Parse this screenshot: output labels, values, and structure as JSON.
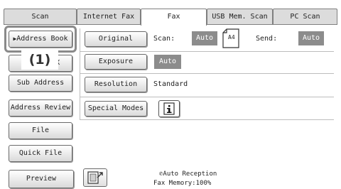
{
  "tabs": [
    {
      "label": "Scan"
    },
    {
      "label": "Internet Fax"
    },
    {
      "label": "Fax"
    },
    {
      "label": "USB Mem. Scan"
    },
    {
      "label": "PC Scan"
    }
  ],
  "left_buttons": {
    "address_book": "Address Book",
    "direct_tx": "Direct TX",
    "sub_address": "Sub Address",
    "address_review": "Address Review",
    "file": "File",
    "quick_file": "Quick File",
    "preview": "Preview"
  },
  "callout": "(1)",
  "settings": {
    "original_btn": "Original",
    "scan_label": "Scan:",
    "scan_value": "Auto",
    "paper_size": "A4",
    "send_label": "Send:",
    "send_value": "Auto",
    "exposure_btn": "Exposure",
    "exposure_value": "Auto",
    "resolution_btn": "Resolution",
    "resolution_value": "Standard",
    "special_modes_btn": "Special Modes"
  },
  "status": {
    "reception": "Auto Reception",
    "memory": "Fax Memory:100%"
  },
  "colors": {
    "highlight": "#8a8a8a",
    "badge": "#8c8c8c"
  }
}
